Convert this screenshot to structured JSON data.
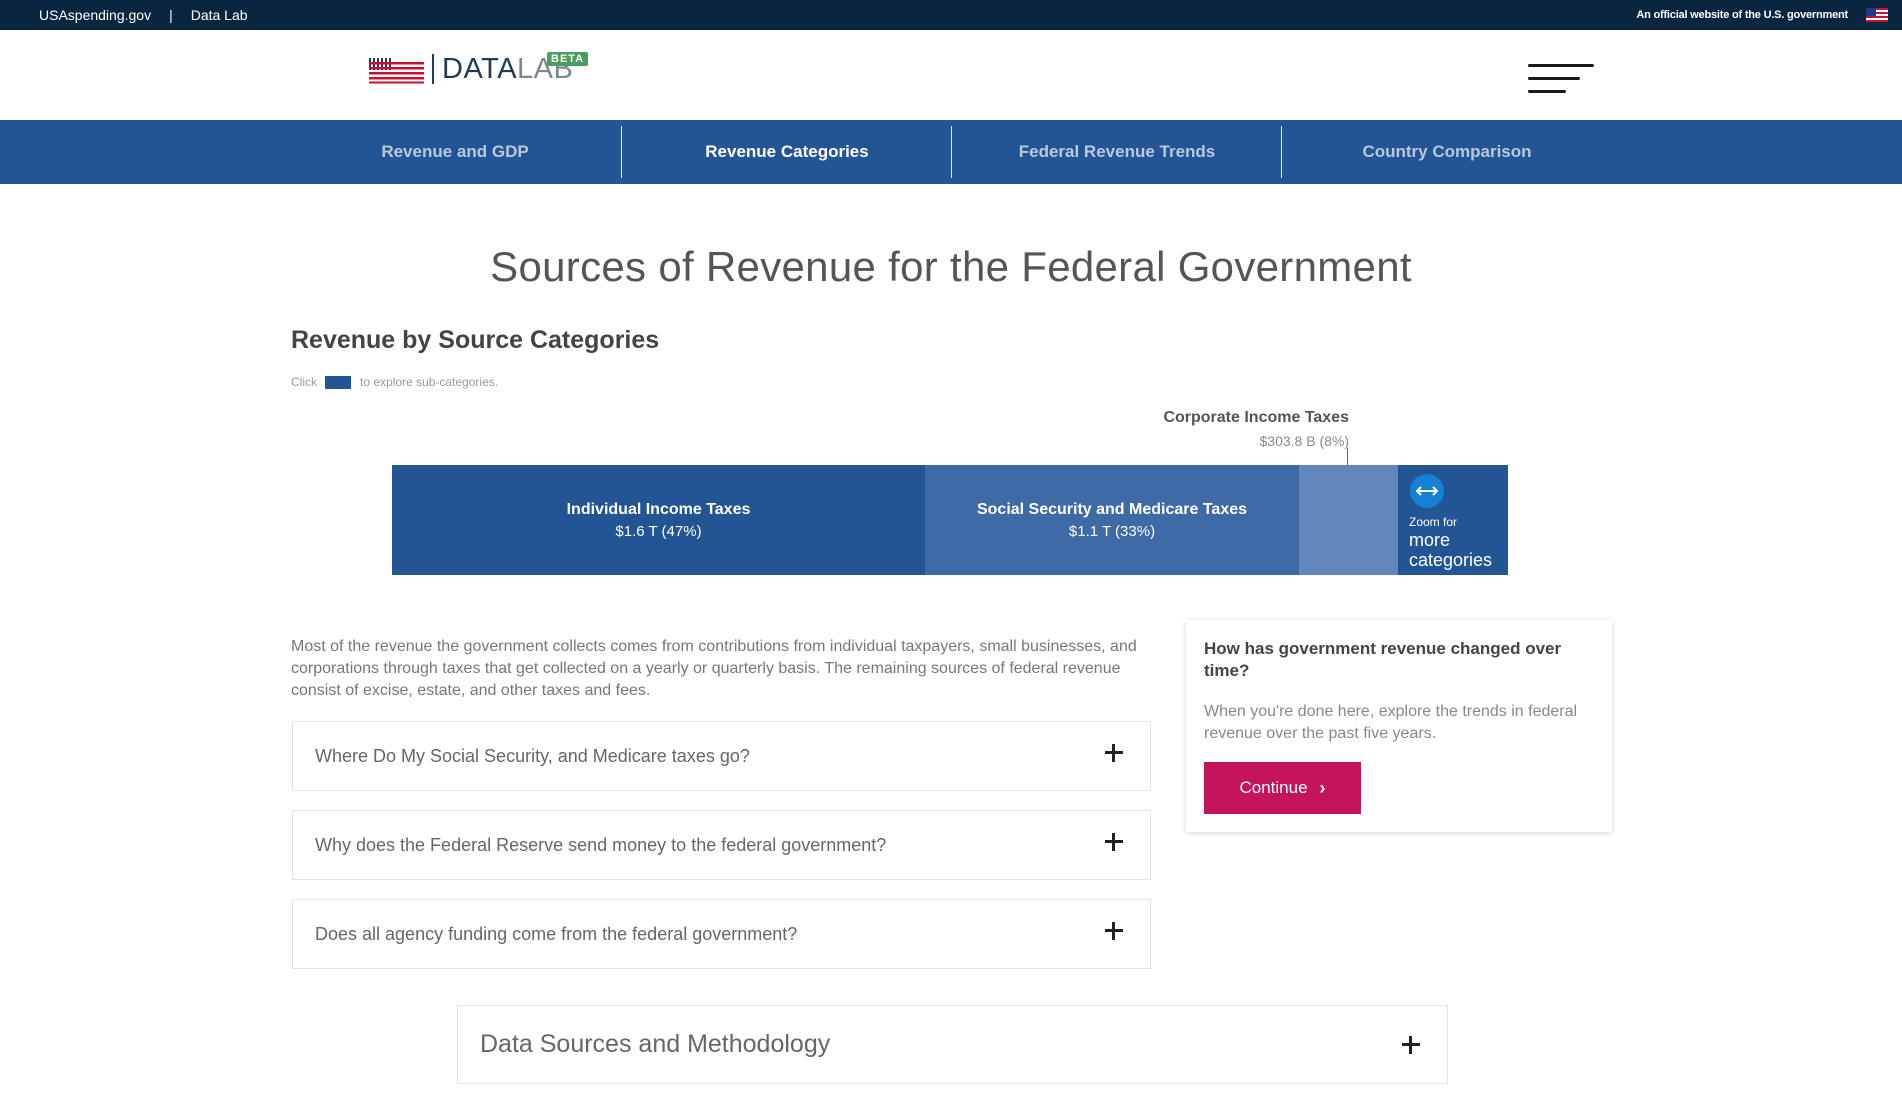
{
  "topbar": {
    "site_link": "USAspending.gov",
    "separator": "|",
    "datalab_link": "Data Lab",
    "official_text": "An official website of the U.S. government",
    "flag_icon": "us-flag-icon"
  },
  "header": {
    "logo_text_main": "DATA",
    "logo_text_lab": "LAB",
    "beta_badge": "BETA",
    "logo_icon": "flag-bars-icon",
    "menu_icon": "hamburger-menu-icon"
  },
  "nav": {
    "tabs": [
      {
        "label": "Revenue and GDP",
        "active": false
      },
      {
        "label": "Revenue Categories",
        "active": true
      },
      {
        "label": "Federal Revenue Trends",
        "active": false
      },
      {
        "label": "Country Comparison",
        "active": false
      }
    ]
  },
  "main": {
    "page_title": "Sources of Revenue for the Federal Government",
    "section_title": "Revenue by Source Categories",
    "hint_before": "Click",
    "hint_after": "to explore sub-categories.",
    "body_text": "Most of the revenue the government collects comes from contributions from individual taxpayers, small businesses, and corporations through taxes that get collected on a yearly or quarterly basis. The remaining sources of federal revenue consist of excise, estate, and other taxes and fees."
  },
  "chart_data": {
    "type": "bar",
    "orientation": "horizontal-stacked",
    "categories": [
      "Individual Income Taxes",
      "Social Security and Medicare Taxes",
      "Corporate Income Taxes",
      "More categories"
    ],
    "value_labels": [
      "$1.6 T (47%)",
      "$1.1 T (33%)",
      "$303.8 B (8%)",
      ""
    ],
    "shares": [
      0.478,
      0.335,
      0.089,
      0.098
    ],
    "colors": [
      "#235594",
      "#3e6aa5",
      "#6287ba",
      "#235594"
    ],
    "callout": {
      "name": "Corporate Income Taxes",
      "value": "$303.8 B (8%)"
    },
    "zoom": {
      "small_label": "Zoom for",
      "large_label_1": "more",
      "large_label_2": "categories",
      "icon": "expand-arrows-icon"
    },
    "title": "",
    "xlabel": "",
    "ylabel": "",
    "grid": false,
    "legend": "none"
  },
  "accordions": [
    {
      "label": "Where Do My Social Security, and Medicare taxes go?"
    },
    {
      "label": "Why does the Federal Reserve send money to the federal government?"
    },
    {
      "label": "Does all agency funding come from the federal government?"
    }
  ],
  "card": {
    "question": "How has government revenue changed over time?",
    "answer": "When you're done here, explore the trends in federal revenue over the past five years.",
    "button_label": "Continue",
    "button_color": "#c4145b"
  },
  "methodology": {
    "label": "Data Sources and Methodology"
  },
  "colors": {
    "topbar": "#0a2540",
    "nav": "#235594",
    "accent": "#c4145b",
    "beta": "#4a9d5b"
  }
}
